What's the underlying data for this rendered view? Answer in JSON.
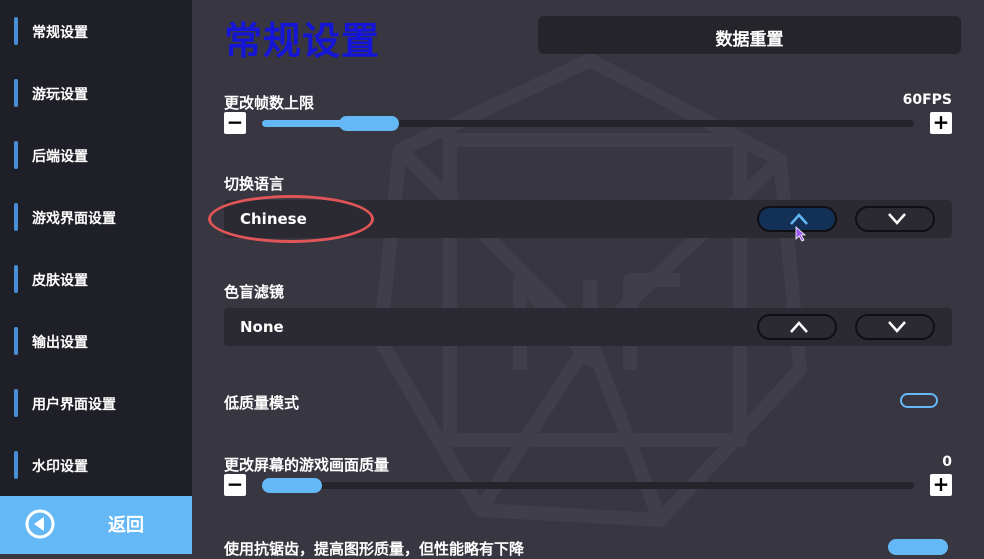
{
  "sidebar": {
    "items": [
      {
        "label": "常规设置"
      },
      {
        "label": "游玩设置"
      },
      {
        "label": "后端设置"
      },
      {
        "label": "游戏界面设置"
      },
      {
        "label": "皮肤设置"
      },
      {
        "label": "输出设置"
      },
      {
        "label": "用户界面设置"
      },
      {
        "label": "水印设置"
      }
    ],
    "back_label": "返回"
  },
  "header": {
    "title": "常规设置",
    "reset_label": "数据重置"
  },
  "settings": {
    "fps": {
      "label": "更改帧数上限",
      "value": "60FPS",
      "level": 0.13
    },
    "language": {
      "label": "切换语言",
      "value": "Chinese"
    },
    "colorblind": {
      "label": "色盲滤镜",
      "value": "None"
    },
    "low_quality": {
      "label": "低质量模式",
      "enabled": false
    },
    "screen_quality": {
      "label": "更改屏幕的游戏画面质量",
      "value": "0",
      "level": 0.0
    },
    "antialias": {
      "label": "使用抗锯齿，提高图形质量，但性能略有下降",
      "enabled": true
    }
  },
  "colors": {
    "accent": "#64b8f5",
    "title": "#1515d8",
    "annotation": "#e05557"
  }
}
